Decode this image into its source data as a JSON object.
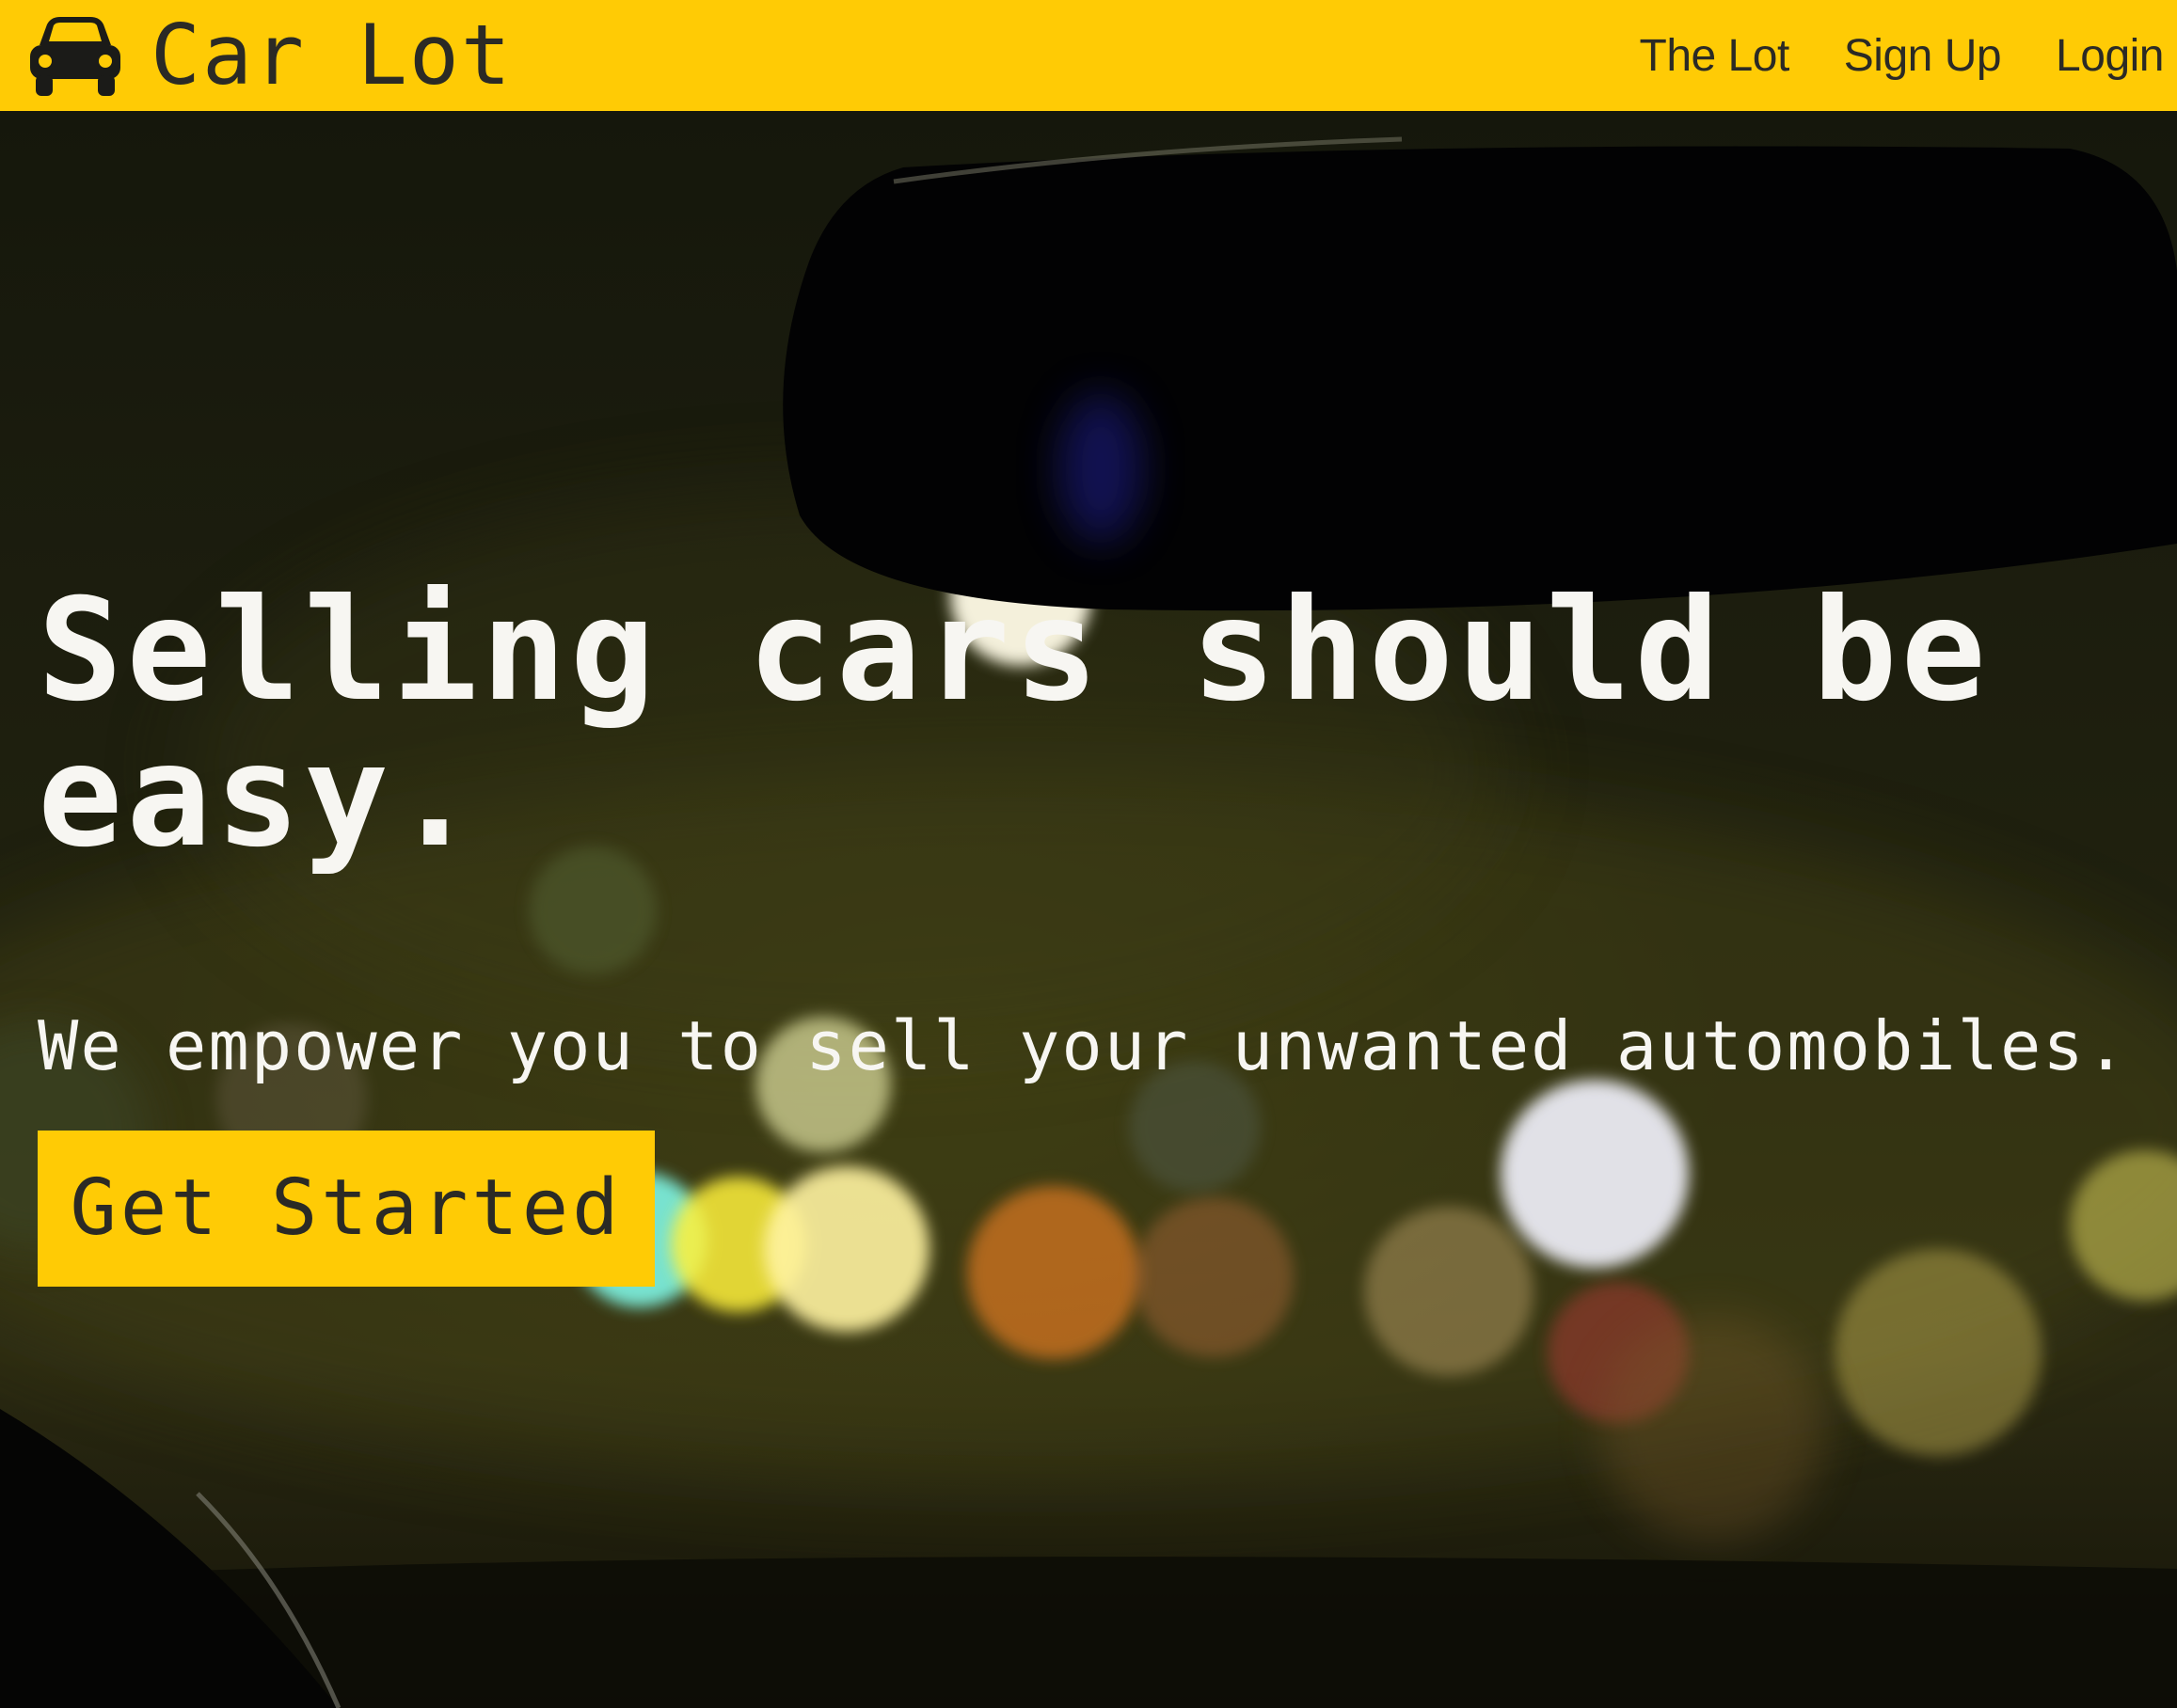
{
  "brand": {
    "name": "Car Lot",
    "icon": "car-icon"
  },
  "nav": {
    "items": [
      {
        "label": "The Lot"
      },
      {
        "label": "Sign Up"
      },
      {
        "label": "Login"
      }
    ]
  },
  "hero": {
    "title": "Selling cars should be easy.",
    "subtitle": "We empower you to sell your unwanted automobiles.",
    "cta_label": "Get Started",
    "background": "night-road-bokeh-through-windshield"
  },
  "colors": {
    "accent": "#ffcb05",
    "text_dark": "#2b2a25",
    "text_light": "#f7f6f2"
  }
}
